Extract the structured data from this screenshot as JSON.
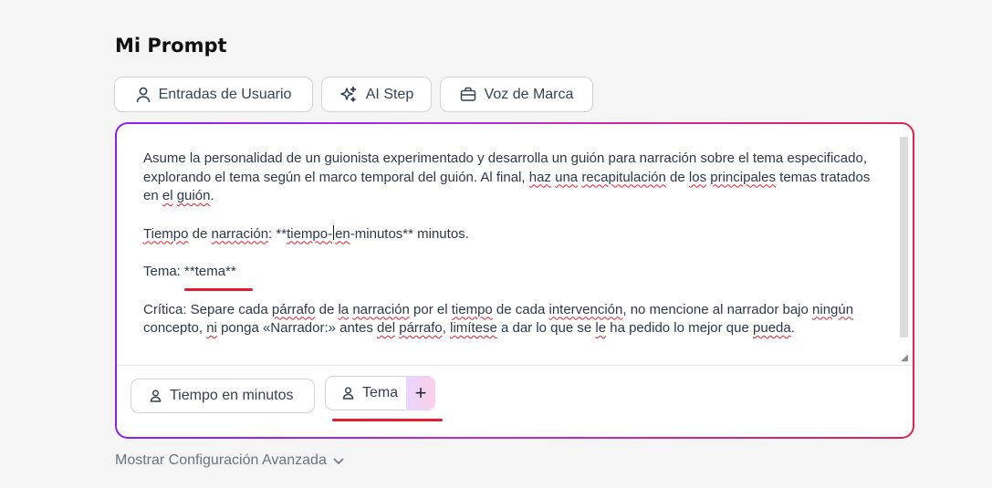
{
  "page": {
    "title": "Mi Prompt"
  },
  "toolbar": {
    "user_inputs": "Entradas de Usuario",
    "ai_step": "AI Step",
    "brand_voice": "Voz de Marca"
  },
  "editor": {
    "p1_a": "Asume la personalidad de un guionista experimentado y desarrolla un guión para narración sobre el tema especificado, explorando el tema según el marco temporal del guión. Al final, ",
    "p1_w1": "haz",
    "p1_w2": "una",
    "p1_w3": "recapitulación",
    "p1_sp": " de ",
    "p1_w4": "los",
    "p1_w5": "principales",
    "p1_b": " temas tratados en ",
    "p1_w6": "el",
    "p1_w7": "guión",
    "p1_end": ".",
    "p2_w1": "Tiempo",
    "p2_a": " de ",
    "p2_w2": "narración",
    "p2_b": ": **",
    "p2_w3": "tiempo-",
    "p2_w4": "en",
    "p2_c": "-minutos** minutos.",
    "p3_label": "Tema: ",
    "p3_var": "**tema**",
    "p4_a": "Crítica: Separe cada ",
    "p4_w1": "párrafo",
    "p4_b": " de ",
    "p4_w2": "la",
    "p4_c": " ",
    "p4_w3": "narración",
    "p4_d": " por el ",
    "p4_w4": "tiempo",
    "p4_e": " de cada ",
    "p4_w5": "intervención",
    "p4_f": ", no mencione al narrador bajo ",
    "p4_w6": "ningún",
    "p4_g": " concepto, ",
    "p4_w7": "ni",
    "p4_h": " ponga «Narrador:» antes ",
    "p4_w8": "del",
    "p4_i": " ",
    "p4_w9": "párrafo",
    "p4_j": ", ",
    "p4_w10": "limítese",
    "p4_k": " a dar lo que se ",
    "p4_w11": "le",
    "p4_l": " ha pedido lo mejor que ",
    "p4_w12": "pueda",
    "p4_end": "."
  },
  "variables": {
    "time_chip": "Tiempo en minutos",
    "topic_chip": "Tema",
    "add_symbol": "+"
  },
  "advanced": {
    "label": "Mostrar Configuración Avanzada"
  },
  "colors": {
    "accent_start": "#8b1ff0",
    "accent_end": "#e0244f",
    "annotation": "#e11d2e"
  }
}
